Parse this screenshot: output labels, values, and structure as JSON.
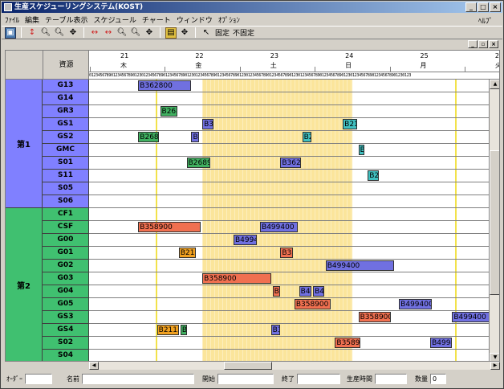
{
  "window": {
    "title": "生産スケジューリングシステム(KOST)"
  },
  "menu": {
    "items": [
      "ﾌｧｲﾙ",
      "編集",
      "テーブル表示",
      "スケジュール",
      "チャート",
      "ウィンドウ",
      "ｵﾌﾟｼｮﾝ"
    ],
    "help": "ﾍﾙﾌﾟ"
  },
  "toolbar": {
    "fixed_label": "固定",
    "unfixed_label": "不固定"
  },
  "grid": {
    "resource_header": "資源",
    "dates": [
      {
        "date": "21",
        "dow": "木"
      },
      {
        "date": "22",
        "dow": "金"
      },
      {
        "date": "23",
        "dow": "土"
      },
      {
        "date": "24",
        "dow": "日"
      },
      {
        "date": "25",
        "dow": "月"
      },
      {
        "date": "26",
        "dow": "火"
      }
    ],
    "hours_text": "0123456789012345678901230123456789012345678901230123456789012345678901230123456789012345678901230123456789012345678901230123456789012345678901230123",
    "groups": [
      {
        "label": "第1",
        "color": "#8080ff",
        "rows": 10
      },
      {
        "label": "第2",
        "color": "#40c070",
        "rows": 12
      }
    ],
    "resources": [
      {
        "name": "G13",
        "color": "#8080ff"
      },
      {
        "name": "G14",
        "color": "#8080ff"
      },
      {
        "name": "GR3",
        "color": "#8080ff"
      },
      {
        "name": "GS1",
        "color": "#8080ff"
      },
      {
        "name": "GS2",
        "color": "#8080ff"
      },
      {
        "name": "GMC",
        "color": "#8080ff"
      },
      {
        "name": "S01",
        "color": "#8080ff"
      },
      {
        "name": "S11",
        "color": "#8080ff"
      },
      {
        "name": "S05",
        "color": "#8080ff"
      },
      {
        "name": "S06",
        "color": "#8080ff"
      },
      {
        "name": "CF1",
        "color": "#40c070"
      },
      {
        "name": "CSF",
        "color": "#40c070"
      },
      {
        "name": "G00",
        "color": "#40c070"
      },
      {
        "name": "G01",
        "color": "#40c070"
      },
      {
        "name": "G02",
        "color": "#40c070"
      },
      {
        "name": "G03",
        "color": "#40c070"
      },
      {
        "name": "G04",
        "color": "#40c070"
      },
      {
        "name": "G05",
        "color": "#40c070"
      },
      {
        "name": "GS3",
        "color": "#40c070"
      },
      {
        "name": "GS4",
        "color": "#40c070"
      },
      {
        "name": "S02",
        "color": "#40c070"
      },
      {
        "name": "S04",
        "color": "#40c070"
      }
    ]
  },
  "tasks": [
    {
      "row": 0,
      "start_h": 15.5,
      "end_h": 32.5,
      "label": "B362800",
      "color": "#7070e0"
    },
    {
      "row": 2,
      "start_h": 22.5,
      "end_h": 28.0,
      "label": "B268",
      "color": "#40b060"
    },
    {
      "row": 3,
      "start_h": 36.0,
      "end_h": 39.5,
      "label": "B3E",
      "color": "#7070e0"
    },
    {
      "row": 3,
      "start_h": 81.0,
      "end_h": 85.5,
      "label": "B21",
      "color": "#40c0c0"
    },
    {
      "row": 4,
      "start_h": 15.5,
      "end_h": 22.0,
      "label": "B2689",
      "color": "#40b060"
    },
    {
      "row": 4,
      "start_h": 32.5,
      "end_h": 35.0,
      "label": "B3",
      "color": "#7070e0"
    },
    {
      "row": 4,
      "start_h": 68.0,
      "end_h": 71.0,
      "label": "B2",
      "color": "#40c0c0"
    },
    {
      "row": 5,
      "start_h": 86.0,
      "end_h": 88.0,
      "label": "B",
      "color": "#40c0c0"
    },
    {
      "row": 6,
      "start_h": 31.0,
      "end_h": 38.5,
      "label": "B26890",
      "color": "#40b060"
    },
    {
      "row": 6,
      "start_h": 61.0,
      "end_h": 67.5,
      "label": "B3628",
      "color": "#7070e0"
    },
    {
      "row": 7,
      "start_h": 89.0,
      "end_h": 92.5,
      "label": "B21",
      "color": "#40c0c0"
    },
    {
      "row": 11,
      "start_h": 15.5,
      "end_h": 35.5,
      "label": "B358900",
      "color": "#f07050"
    },
    {
      "row": 11,
      "start_h": 54.5,
      "end_h": 66.5,
      "label": "B499400",
      "color": "#7070e0"
    },
    {
      "row": 12,
      "start_h": 46.0,
      "end_h": 53.5,
      "label": "B49940",
      "color": "#7070e0"
    },
    {
      "row": 13,
      "start_h": 28.5,
      "end_h": 34.0,
      "label": "B211",
      "color": "#f0a020"
    },
    {
      "row": 13,
      "start_h": 61.0,
      "end_h": 65.0,
      "label": "B35",
      "color": "#f07050"
    },
    {
      "row": 14,
      "start_h": 75.5,
      "end_h": 97.5,
      "label": "B499400",
      "color": "#7070e0"
    },
    {
      "row": 15,
      "start_h": 36.0,
      "end_h": 58.0,
      "label": "B358900",
      "color": "#f07050"
    },
    {
      "row": 16,
      "start_h": 58.5,
      "end_h": 61.0,
      "label": "B",
      "color": "#f07050"
    },
    {
      "row": 16,
      "start_h": 67.0,
      "end_h": 71.0,
      "label": "B49",
      "color": "#7070e0"
    },
    {
      "row": 16,
      "start_h": 71.5,
      "end_h": 75.0,
      "label": "B49",
      "color": "#7070e0"
    },
    {
      "row": 17,
      "start_h": 65.5,
      "end_h": 77.0,
      "label": "B358900",
      "color": "#f07050"
    },
    {
      "row": 17,
      "start_h": 99.0,
      "end_h": 109.5,
      "label": "B499400",
      "color": "#7070e0"
    },
    {
      "row": 18,
      "start_h": 86.0,
      "end_h": 96.5,
      "label": "B358900",
      "color": "#f07050"
    },
    {
      "row": 18,
      "start_h": 116.0,
      "end_h": 128.0,
      "label": "B499400",
      "color": "#7070e0"
    },
    {
      "row": 19,
      "start_h": 21.5,
      "end_h": 28.5,
      "label": "B2115",
      "color": "#f0a020"
    },
    {
      "row": 19,
      "start_h": 29.0,
      "end_h": 31.0,
      "label": "B",
      "color": "#40b060"
    },
    {
      "row": 19,
      "start_h": 58.0,
      "end_h": 61.0,
      "label": "B3",
      "color": "#7070e0"
    },
    {
      "row": 20,
      "start_h": 78.5,
      "end_h": 86.5,
      "label": "B3589",
      "color": "#f07050"
    },
    {
      "row": 20,
      "start_h": 109.0,
      "end_h": 116.0,
      "label": "B4994",
      "color": "#7070e0"
    }
  ],
  "statusbar": {
    "order_label": "ｵｰﾀﾞｰ",
    "name_label": "名前",
    "start_label": "開始",
    "end_label": "終了",
    "prod_time_label": "生産時間",
    "qty_label": "数量",
    "qty_value": "0"
  }
}
